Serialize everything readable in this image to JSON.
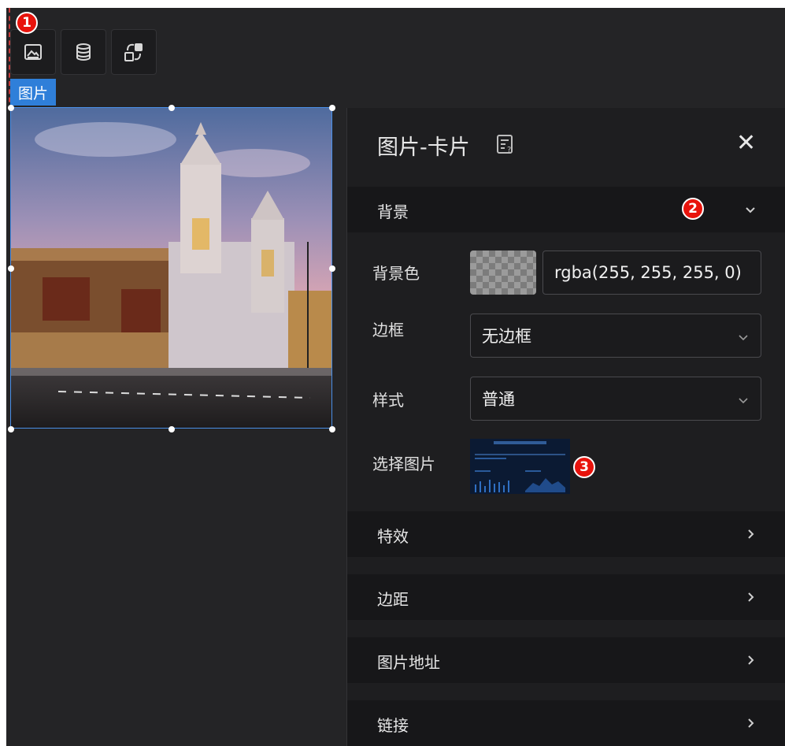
{
  "toolbar": {
    "buttons": [
      {
        "name": "image-icon"
      },
      {
        "name": "database-icon"
      },
      {
        "name": "interaction-icon"
      }
    ],
    "badge1": "1"
  },
  "component": {
    "tag_label": "图片"
  },
  "panel": {
    "title": "图片-卡片",
    "sections": {
      "background": "背景",
      "effects": "特效",
      "margin": "边距",
      "image_url": "图片地址",
      "link": "链接"
    },
    "badge2": "2",
    "badge3": "3",
    "properties": {
      "bg_color_label": "背景色",
      "bg_color_value": "rgba(255, 255, 255, 0)",
      "border_label": "边框",
      "border_value": "无边框",
      "style_label": "样式",
      "style_value": "普通",
      "select_image_label": "选择图片"
    }
  },
  "colors": {
    "canvas": "#242426",
    "panel": "#1e1e20",
    "section_bar": "#171719",
    "accent_blue": "#2f7fd9",
    "badge_red": "#e8130c"
  }
}
